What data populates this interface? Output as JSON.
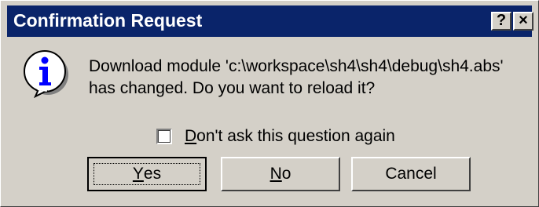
{
  "dialog": {
    "title": "Confirmation Request",
    "help_button": "?",
    "close_button": "×",
    "icon": "info-icon",
    "message_line1": "Download module 'c:\\workspace\\sh4\\sh4\\debug\\sh4.abs'",
    "message_line2": "has changed. Do you want to reload it?",
    "checkbox": {
      "label_mnemonic": "D",
      "label_rest": "on't ask this question again",
      "checked": false
    },
    "buttons": {
      "yes_mnemonic": "Y",
      "yes_rest": "es",
      "no_mnemonic": "N",
      "no_rest": "o",
      "cancel": "Cancel"
    },
    "colors": {
      "titlebar": "#0a246a",
      "face": "#d4d0c8",
      "icon_blue": "#0000ff"
    }
  }
}
